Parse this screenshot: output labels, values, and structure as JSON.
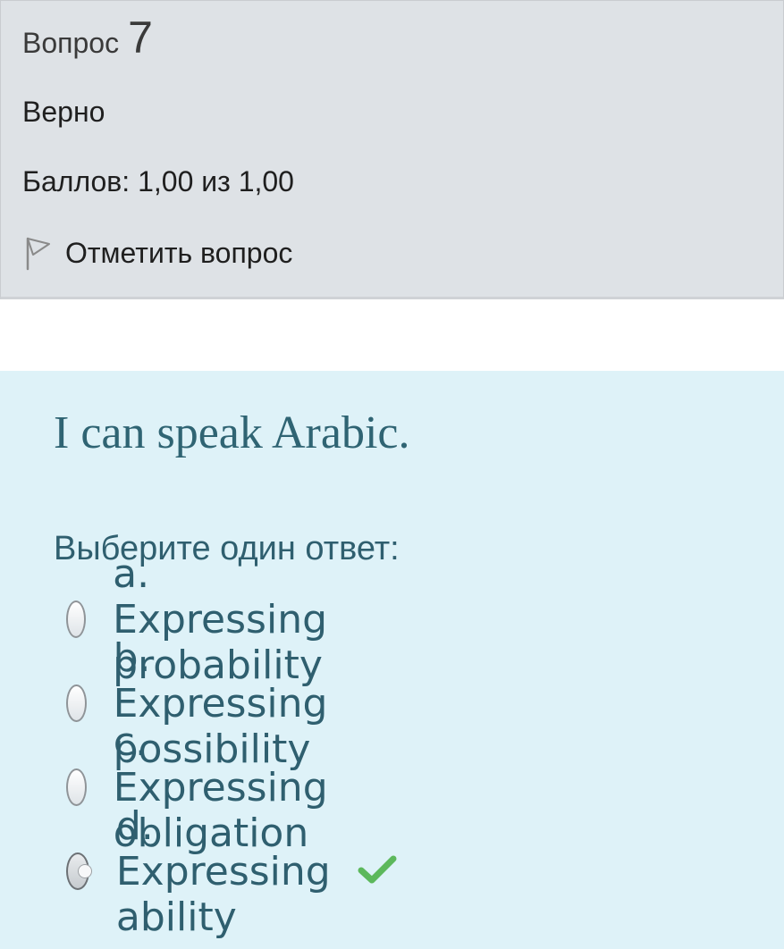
{
  "question_info": {
    "label": "Вопрос",
    "number": "7",
    "state": "Верно",
    "grade": "Баллов: 1,00 из 1,00",
    "flag_label": "Отметить вопрос",
    "flag_icon": "flag-icon"
  },
  "question": {
    "text": "I can speak Arabic.",
    "prompt": "Выберите один ответ:",
    "answers": [
      {
        "label": "a. Expressing probability",
        "selected": false
      },
      {
        "label": "b. Expressing possibility",
        "selected": false
      },
      {
        "label": "c. Expressing obligation",
        "selected": false
      },
      {
        "label": "d. Expressing ability",
        "selected": true,
        "correct_icon": "checkmark-icon"
      }
    ]
  },
  "colors": {
    "info_bg": "#dee2e6",
    "content_bg": "#def2f8",
    "text_teal": "#2f5f6f",
    "check_green": "#5cb85c"
  }
}
